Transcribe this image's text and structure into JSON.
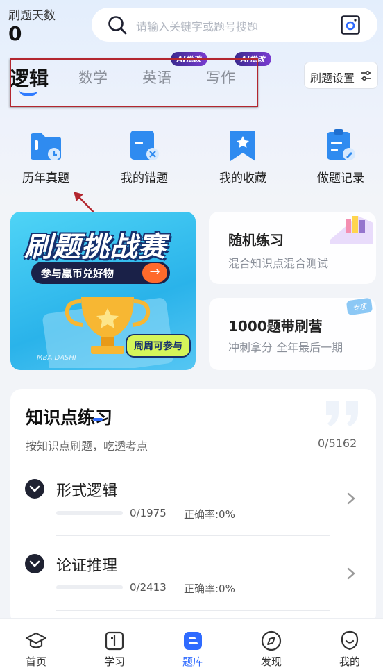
{
  "header": {
    "days_label": "刷题天数",
    "days_value": "0",
    "search_placeholder": "请输入关键字或题号搜题"
  },
  "tabs": [
    {
      "label": "逻辑",
      "active": true
    },
    {
      "label": "数学",
      "active": false
    },
    {
      "label": "英语",
      "active": false,
      "badge": "AI批改"
    },
    {
      "label": "写作",
      "active": false,
      "badge": "AI批改"
    }
  ],
  "settings_label": "刷题设置",
  "quick_links": [
    {
      "label": "历年真题",
      "icon": "folder-clock-icon"
    },
    {
      "label": "我的错题",
      "icon": "wrong-note-icon"
    },
    {
      "label": "我的收藏",
      "icon": "star-bookmark-icon"
    },
    {
      "label": "做题记录",
      "icon": "clipboard-pen-icon"
    }
  ],
  "banner": {
    "title": "刷题挑战赛",
    "subtitle": "参与赢币兑好物",
    "pill": "周周可参与",
    "footer": "MBA DASHI"
  },
  "cards": [
    {
      "title": "随机练习",
      "subtitle": "混合知识点混合测试"
    },
    {
      "title": "1000题带刷营",
      "subtitle": "冲刺拿分  全年最后一期",
      "badge": "专项"
    }
  ],
  "knowledge": {
    "title": "知识点练习",
    "desc": "按知识点刷题，吃透考点",
    "count": "0/5162",
    "items": [
      {
        "name": "形式逻辑",
        "count": "0/1975",
        "accuracy": "正确率:0%",
        "progress": 0
      },
      {
        "name": "论证推理",
        "count": "0/2413",
        "accuracy": "正确率:0%",
        "progress": 0
      }
    ]
  },
  "nav": [
    {
      "label": "首页",
      "icon": "graduation-cap-icon",
      "active": false
    },
    {
      "label": "学习",
      "icon": "book-icon",
      "active": false
    },
    {
      "label": "题库",
      "icon": "question-bank-icon",
      "active": true
    },
    {
      "label": "发现",
      "icon": "compass-icon",
      "active": false
    },
    {
      "label": "我的",
      "icon": "smile-face-icon",
      "active": false
    }
  ],
  "colors": {
    "accent": "#2f6bff",
    "annotation": "#b3262f"
  }
}
